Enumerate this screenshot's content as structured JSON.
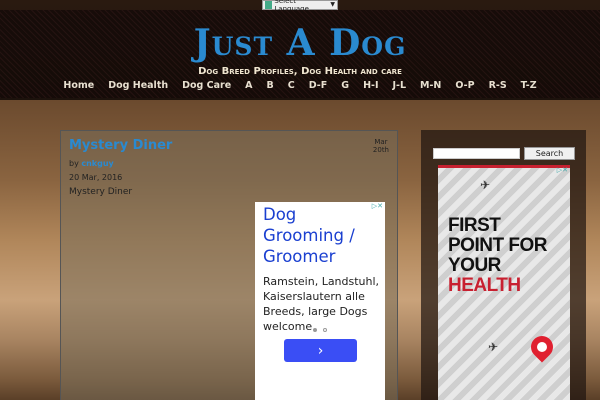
{
  "language_selector": {
    "label": "Select Language"
  },
  "site": {
    "title": "Just A Dog",
    "tagline": "Dog Breed Profiles, Dog Health and care"
  },
  "nav": {
    "items": [
      "Home",
      "Dog Health",
      "Dog Care",
      "A",
      "B",
      "C",
      "D-F",
      "G",
      "H-I",
      "J-L",
      "M-N",
      "O-P",
      "R-S",
      "T-Z"
    ]
  },
  "post": {
    "title": "Mystery Diner",
    "badge_month": "Mar",
    "badge_day": "20th",
    "by_label": "by",
    "author": "cnkguy",
    "date": "20 Mar, 2016",
    "body": "Mystery Diner"
  },
  "ad1": {
    "title": "Dog Grooming / Groomer",
    "text": "Ramstein, Landstuhl, Kaiserslautern alle Breeds, large Dogs welcome",
    "button_icon": "chevron-right-icon"
  },
  "sidebar": {
    "search_placeholder": "",
    "search_button": "Search"
  },
  "ad2": {
    "headline_line1": "FIRST",
    "headline_line2": "POINT FOR",
    "headline_line3": "YOUR",
    "headline_line4": "HEALTH"
  }
}
